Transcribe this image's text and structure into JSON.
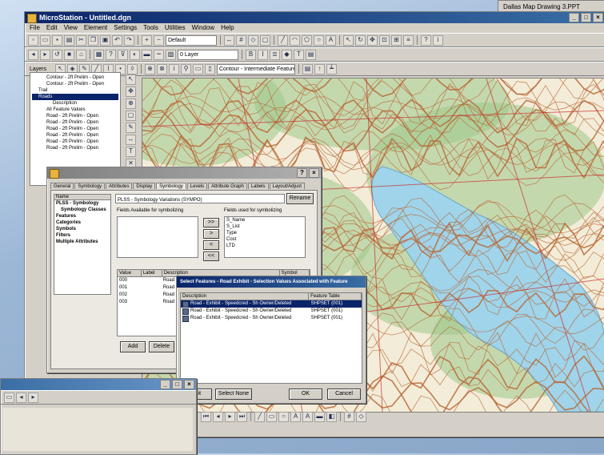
{
  "app": {
    "title": "MicroStation - Untitled.dgn",
    "menus": [
      "File",
      "Edit",
      "View",
      "Element",
      "Settings",
      "Tools",
      "Utilities",
      "Window",
      "Help"
    ],
    "right_window_title": "Dallas Map Drawing 3.PPT"
  },
  "toolbars": {
    "row1_combo": "Default",
    "row2_combo": "0 Layer",
    "row3_label": "Layers",
    "row3_combo": "Contour - Intermediate Feature"
  },
  "tree": {
    "items": [
      {
        "label": "Contour - 2ft Prelim - Open"
      },
      {
        "label": "Contour - 2ft Prelim - Open"
      },
      {
        "label": "Trail"
      },
      {
        "label": "Roads"
      },
      {
        "label": "Description"
      },
      {
        "label": "All Feature Values"
      },
      {
        "label": "Road - 2ft Prelim - Open"
      },
      {
        "label": "Road - 2ft Prelim - Open"
      },
      {
        "label": "Road - 2ft Prelim - Open"
      },
      {
        "label": "Road - 2ft Prelim - Open"
      },
      {
        "label": "Road - 2ft Prelim - Open"
      },
      {
        "label": "Road - 2ft Prelim - Open"
      }
    ],
    "selected_index": 3
  },
  "properties_dialog": {
    "tabs": [
      "General",
      "Symbology",
      "Attributes",
      "Display",
      "Symbology",
      "Levels",
      "Attribute Graph",
      "Labels",
      "Layout/Adjust"
    ],
    "active_tab": 4,
    "left_list": {
      "header": "Name",
      "items": [
        "PLSS - Symbology",
        "Symbology Classes",
        "Features",
        "Categories",
        "Symbols",
        "Filters",
        "Multiple Attributes"
      ]
    },
    "name_field": "PLSS - Symbology Variations (SYMPO)",
    "rename_button": "Rename",
    "available_label": "Fields Available for symbolizing",
    "used_label": "Fields used for symbolizing",
    "used_fields": [
      "S_Name",
      "S_List",
      "Type",
      "Cost",
      "LTD"
    ],
    "move_buttons": [
      ">>",
      ">",
      "<",
      "<<"
    ],
    "lower_table_header": [
      "Value",
      "Label",
      "Description",
      "Symbol"
    ],
    "lower_table_rows": [
      [
        "000",
        "",
        "Road - Exhibit",
        ""
      ],
      [
        "001",
        "",
        "Road - Exhibit",
        ""
      ],
      [
        "002",
        "",
        "Road - Exhibit",
        ""
      ],
      [
        "003",
        "",
        "Road - Exhibit",
        ""
      ]
    ],
    "add_button": "Add",
    "delete_button": "Delete"
  },
  "front_dialog": {
    "title": "Select Features - Road Exhibit - Selection Values Associated with Feature",
    "columns": [
      "Description",
      "Feature Table"
    ],
    "rows": [
      {
        "description": "Road - Exhibit - Speedcred - Sh Owner/Deleted",
        "table": "SHPSET (001)"
      },
      {
        "description": "Road - Exhibit - Speedcred - Sh Owner/Deleted",
        "table": "SHPSET (001)"
      },
      {
        "description": "Road - Exhibit - Speedcred - Sh Owner/Deleted",
        "table": "SHPSET (001)"
      }
    ],
    "selected_row": 0,
    "left_buttons": [
      "Edit",
      "Select None"
    ],
    "ok_button": "OK",
    "cancel_button": "Cancel"
  },
  "colors": {
    "title_start": "#0a246a",
    "title_end": "#3a6ea5",
    "map_water": "#9fd4ea",
    "map_contour": "#b86a3a",
    "map_vegetation": "#9cc88a",
    "map_road": "#c83030"
  }
}
